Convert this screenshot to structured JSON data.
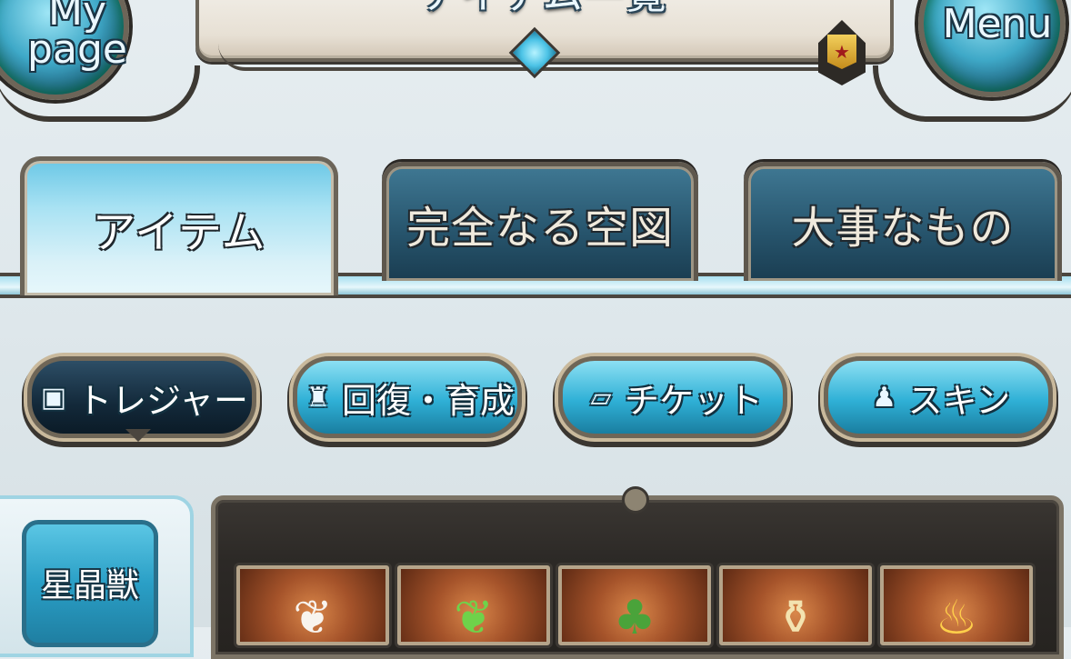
{
  "header": {
    "title": "アイテム一覧",
    "mypage_label_line1": "My",
    "mypage_label_line2": "page",
    "menu_label": "Menu",
    "rank_badge_glyph": "★"
  },
  "tabs": [
    {
      "label": "アイテム",
      "active": true
    },
    {
      "label": "完全なる空図",
      "active": false
    },
    {
      "label": "大事なもの",
      "active": false
    }
  ],
  "filters": [
    {
      "label": "トレジャー",
      "icon": "treasure-chest-icon",
      "glyph": "▣",
      "selected": true
    },
    {
      "label": "回復・育成",
      "icon": "potion-bottle-icon",
      "glyph": "♜",
      "selected": false
    },
    {
      "label": "チケット",
      "icon": "ticket-icon",
      "glyph": "▱",
      "selected": false
    },
    {
      "label": "スキン",
      "icon": "outfit-icon",
      "glyph": "♟",
      "selected": false
    }
  ],
  "side_panel": {
    "button_label": "星晶獣"
  },
  "items": [
    {
      "icon": "white-feather-icon",
      "glyph": "❦"
    },
    {
      "icon": "green-feather-icon",
      "glyph": "❦"
    },
    {
      "icon": "leaf-sprout-icon",
      "glyph": "♣"
    },
    {
      "icon": "potion-flask-icon",
      "glyph": "⚱"
    },
    {
      "icon": "flame-icon",
      "glyph": "♨"
    }
  ],
  "colors": {
    "accent_cyan": "#2fb0d6",
    "frame_dark": "#3b3732",
    "tab_inactive": "#26536b",
    "item_panel": "#2c2926"
  }
}
